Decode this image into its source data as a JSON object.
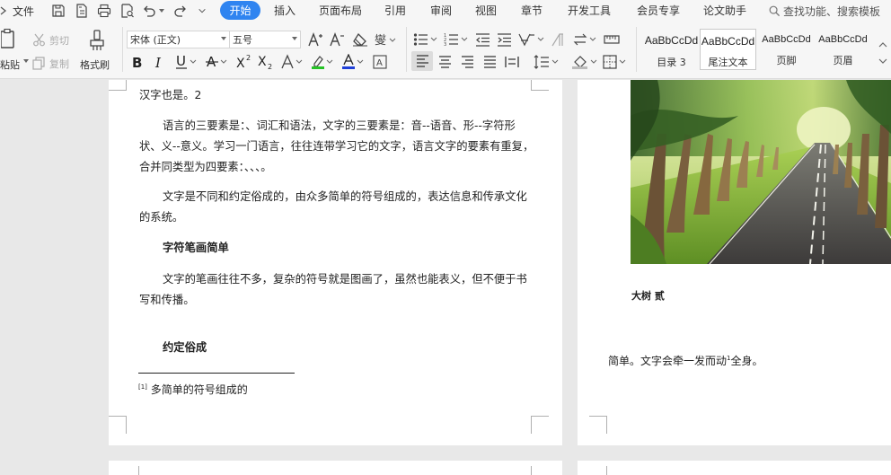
{
  "menubar": {
    "file_label": "文件",
    "tabs": [
      "开始",
      "插入",
      "页面布局",
      "引用",
      "审阅",
      "视图",
      "章节",
      "开发工具",
      "会员专享",
      "论文助手"
    ],
    "search_placeholder": "查找功能、搜索模板"
  },
  "ribbon": {
    "paste_label": "粘贴",
    "cut_label": "剪切",
    "copy_label": "复制",
    "format_painter_label": "格式刷",
    "font_name": "宋体 (正文)",
    "font_size": "五号",
    "styles": [
      {
        "sample": "AaBbCcDd",
        "name": "目录 3"
      },
      {
        "sample": "AaBbCcDd",
        "name": "尾注文本"
      },
      {
        "sample": "AaBbCcDd",
        "name": "页脚"
      },
      {
        "sample": "AaBbCcDd",
        "name": "页眉"
      }
    ]
  },
  "document": {
    "left_page": {
      "line_top": "汉字也是。2",
      "para1_line1": "语言的三要素是：、词汇和语法，文字的三要素是：音--语音、形--字符形",
      "para1_line2": "状、义--意义。学习一门语言，往往连带学习它的文字，语言文字的要素有重复，",
      "para1_line3": "合并同类型为四要素：、、、。",
      "para2_line1": "文字是不同和约定俗成的，由众多简单的符号组成的，表达信息和传承文化",
      "para2_line2": "的系统。",
      "heading1": "字符笔画简单",
      "para3_line1": "文字的笔画往往不多，复杂的符号就是图画了，虽然也能表义，但不便于书",
      "para3_line2": "写和传播。",
      "heading2": "约定俗成",
      "footnote_mark": "[1]",
      "footnote_text": "多简单的符号组成的"
    },
    "right_page": {
      "caption": "大树  贰",
      "body_text": "简单。文字会牵一发而动",
      "body_sup": "1",
      "body_tail": "全身。"
    }
  },
  "colors": {
    "accent": "#2f84f0",
    "page_bg": "#ffffff",
    "workspace_bg": "#e8e8e8",
    "ribbon_bg": "#f6f6f6"
  }
}
